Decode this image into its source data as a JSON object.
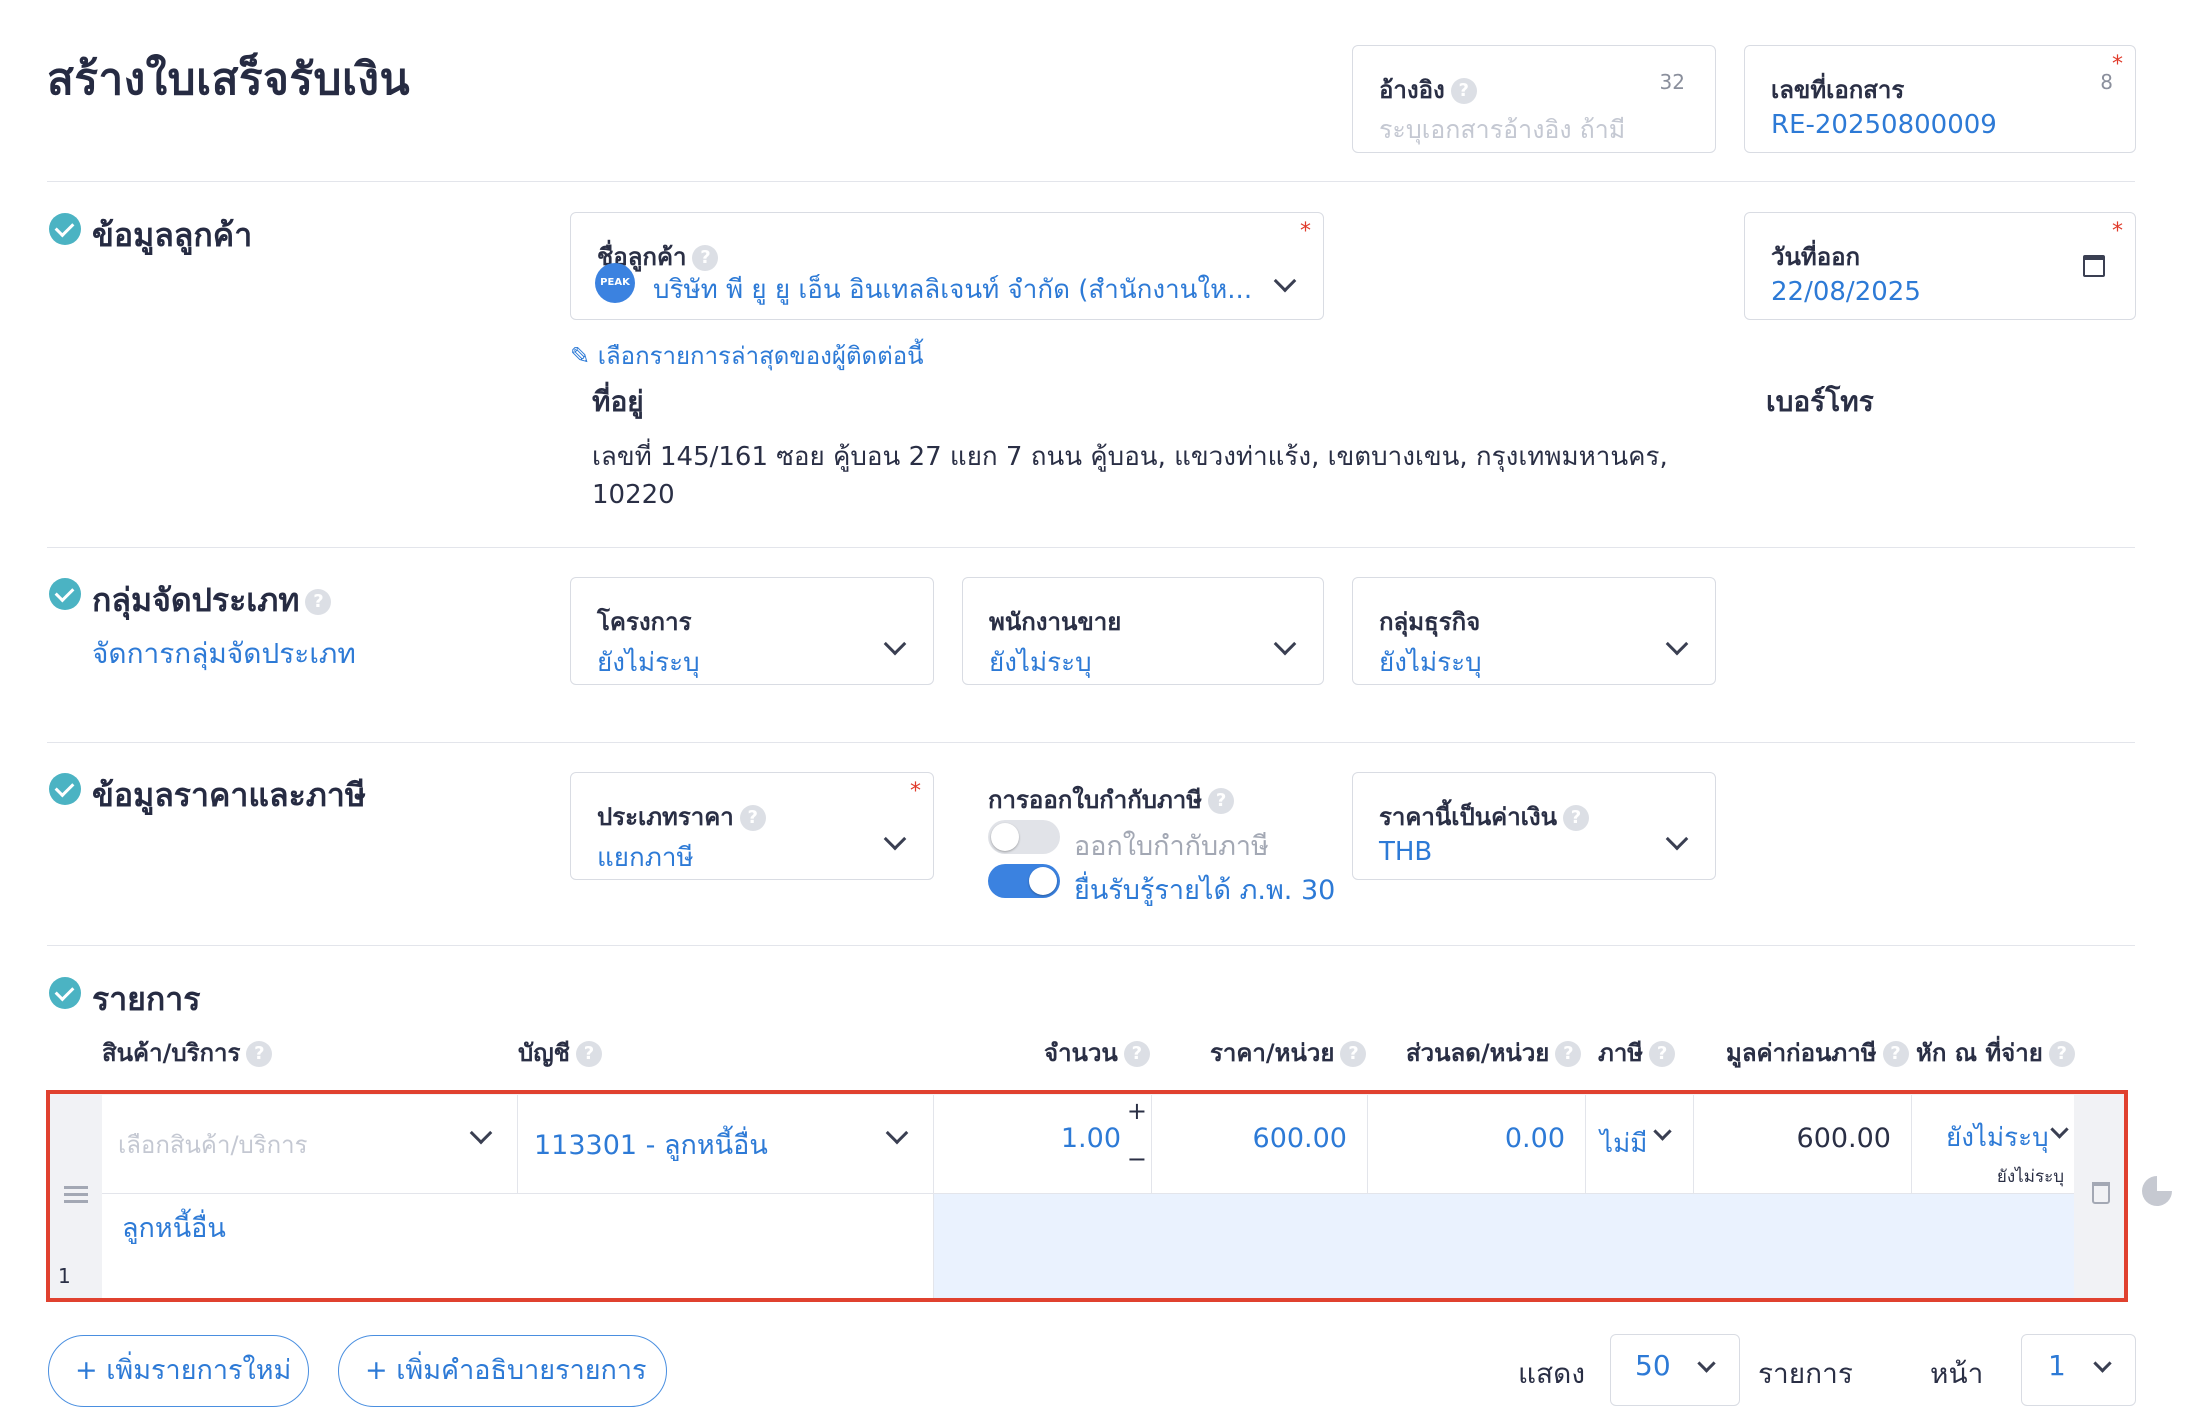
{
  "page": {
    "title": "สร้างใบเสร็จรับเงิน"
  },
  "header": {
    "reference": {
      "label": "อ้างอิง",
      "counter": "32",
      "placeholder": "ระบุเอกสารอ้างอิง ถ้ามี"
    },
    "doc_number": {
      "label": "เลขที่เอกสาร",
      "counter": "8",
      "value": "RE-20250800009"
    }
  },
  "customer": {
    "section_title": "ข้อมูลลูกค้า",
    "name_label": "ชื่อลูกค้า",
    "avatar_text": "PEAK",
    "name_value": "บริษัท พี ยู ยู เอ็น อินเทลลิเจนท์ จำกัด (สำนักงานให...",
    "recent_link": "เลือกรายการล่าสุดของผู้ติดต่อนี้",
    "address_label": "ที่อยู่",
    "address_line1": "เลขที่ 145/161 ซอย คู้บอน 27 แยก 7 ถนน คู้บอน, แขวงท่าแร้ง, เขตบางเขน, กรุงเทพมหานคร,",
    "address_line2": "10220",
    "phone_label": "เบอร์โทร",
    "issue_date_label": "วันที่ออก",
    "issue_date_value": "22/08/2025"
  },
  "classification": {
    "section_title": "กลุ่มจัดประเภท",
    "manage_link": "จัดการกลุ่มจัดประเภท",
    "project": {
      "label": "โครงการ",
      "value": "ยังไม่ระบุ"
    },
    "salesperson": {
      "label": "พนักงานขาย",
      "value": "ยังไม่ระบุ"
    },
    "business_group": {
      "label": "กลุ่มธุรกิจ",
      "value": "ยังไม่ระบุ"
    }
  },
  "pricing": {
    "section_title": "ข้อมูลราคาและภาษี",
    "price_type": {
      "label": "ประเภทราคา",
      "value": "แยกภาษี"
    },
    "tax_invoice": {
      "label": "การออกใบกำกับภาษี",
      "toggle1": "ออกใบกำกับภาษี",
      "toggle1_on": false,
      "toggle2": "ยื่นรับรู้รายได้ ภ.พ. 30",
      "toggle2_on": true
    },
    "currency": {
      "label": "ราคานี้เป็นค่าเงิน",
      "value": "THB"
    }
  },
  "items": {
    "section_title": "รายการ",
    "columns": {
      "product": "สินค้า/บริการ",
      "account": "บัญชี",
      "qty": "จำนวน",
      "price": "ราคา/หน่วย",
      "discount": "ส่วนลด/หน่วย",
      "tax": "ภาษี",
      "pretax": "มูลค่าก่อนภาษี",
      "wht": "หัก ณ ที่จ่าย"
    },
    "row": {
      "index": "1",
      "product_placeholder": "เลือกสินค้า/บริการ",
      "account": "113301 - ลูกหนี้อื่น",
      "qty": "1.00",
      "price": "600.00",
      "discount": "0.00",
      "tax": "ไม่มี",
      "pretax": "600.00",
      "wht": "ยังไม่ระบุ",
      "wht_sub": "ยังไม่ระบุ",
      "description": "ลูกหนี้อื่น"
    },
    "add_item": "+ เพิ่มรายการใหม่",
    "add_description": "+ เพิ่มคำอธิบายรายการ"
  },
  "pager": {
    "show_label": "แสดง",
    "per_page": "50",
    "items_label": "รายการ",
    "page_label": "หน้า",
    "page": "1"
  },
  "colors": {
    "accent": "#2d7ad6",
    "check": "#4bb3c3",
    "highlight_border": "#e0412f",
    "required": "#e03b2b"
  }
}
